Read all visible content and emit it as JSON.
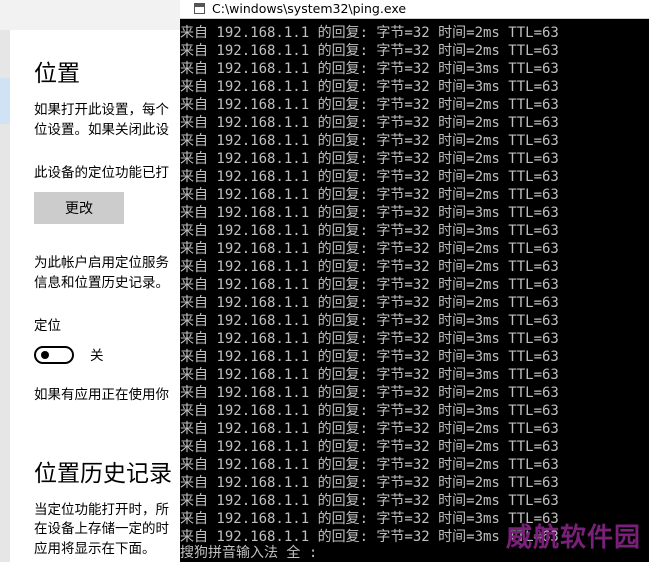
{
  "settings": {
    "title": "位置",
    "para1_line1": "如果打开此设置，每个",
    "para1_line2": "位设置。如果关闭此设",
    "device_status": "此设备的定位功能已打",
    "change_button": "更改",
    "para2_line1": "为此帐户启用定位服务",
    "para2_line2": "信息和位置历史记录。",
    "location_label": "定位",
    "toggle_state": "关",
    "apps_using": "如果有应用正在使用你",
    "history_title": "位置历史记录",
    "history_line1": "当定位功能打开时，所",
    "history_line2": "在设备上存储一定的时",
    "history_line3": "应用将显示在下面。"
  },
  "console": {
    "title": "C:\\windows\\system32\\ping.exe",
    "lines": [
      "来自 192.168.1.1 的回复: 字节=32 时间=2ms TTL=63",
      "来自 192.168.1.1 的回复: 字节=32 时间=2ms TTL=63",
      "来自 192.168.1.1 的回复: 字节=32 时间=3ms TTL=63",
      "来自 192.168.1.1 的回复: 字节=32 时间=3ms TTL=63",
      "来自 192.168.1.1 的回复: 字节=32 时间=2ms TTL=63",
      "来自 192.168.1.1 的回复: 字节=32 时间=2ms TTL=63",
      "来自 192.168.1.1 的回复: 字节=32 时间=2ms TTL=63",
      "来自 192.168.1.1 的回复: 字节=32 时间=2ms TTL=63",
      "来自 192.168.1.1 的回复: 字节=32 时间=2ms TTL=63",
      "来自 192.168.1.1 的回复: 字节=32 时间=2ms TTL=63",
      "来自 192.168.1.1 的回复: 字节=32 时间=3ms TTL=63",
      "来自 192.168.1.1 的回复: 字节=32 时间=3ms TTL=63",
      "来自 192.168.1.1 的回复: 字节=32 时间=2ms TTL=63",
      "来自 192.168.1.1 的回复: 字节=32 时间=2ms TTL=63",
      "来自 192.168.1.1 的回复: 字节=32 时间=2ms TTL=63",
      "来自 192.168.1.1 的回复: 字节=32 时间=2ms TTL=63",
      "来自 192.168.1.1 的回复: 字节=32 时间=3ms TTL=63",
      "来自 192.168.1.1 的回复: 字节=32 时间=3ms TTL=63",
      "来自 192.168.1.1 的回复: 字节=32 时间=3ms TTL=63",
      "来自 192.168.1.1 的回复: 字节=32 时间=3ms TTL=63",
      "来自 192.168.1.1 的回复: 字节=32 时间=2ms TTL=63",
      "来自 192.168.1.1 的回复: 字节=32 时间=3ms TTL=63",
      "来自 192.168.1.1 的回复: 字节=32 时间=2ms TTL=63",
      "来自 192.168.1.1 的回复: 字节=32 时间=2ms TTL=63",
      "来自 192.168.1.1 的回复: 字节=32 时间=2ms TTL=63",
      "来自 192.168.1.1 的回复: 字节=32 时间=2ms TTL=63",
      "来自 192.168.1.1 的回复: 字节=32 时间=2ms TTL=63",
      "来自 192.168.1.1 的回复: 字节=32 时间=3ms TTL=63",
      "来自 192.168.1.1 的回复: 字节=32 时间=3ms TTL=63"
    ],
    "ime_status": "搜狗拼音输入法 全 :"
  },
  "watermark": "威航软件园"
}
